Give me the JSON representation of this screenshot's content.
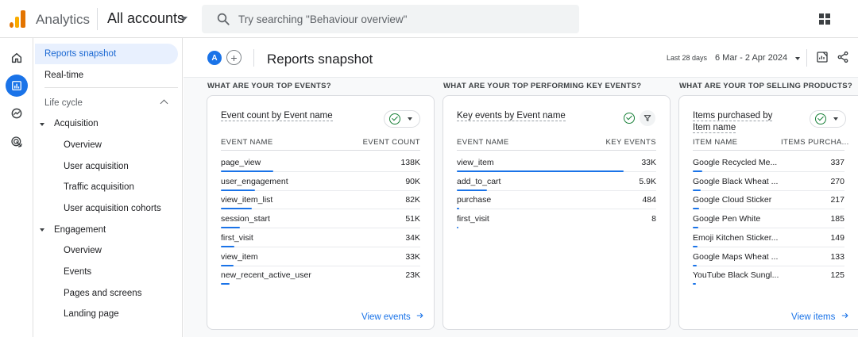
{
  "topbar": {
    "app_name": "Analytics",
    "accounts_label": "All accounts",
    "search_placeholder": "Try searching \"Behaviour overview\""
  },
  "nav": {
    "reports_snapshot": "Reports snapshot",
    "realtime": "Real-time",
    "lifecycle": "Life cycle",
    "acquisition": "Acquisition",
    "acq_items": [
      "Overview",
      "User acquisition",
      "Traffic acquisition",
      "User acquisition cohorts"
    ],
    "engagement": "Engagement",
    "eng_items": [
      "Overview",
      "Events",
      "Pages and screens",
      "Landing page"
    ]
  },
  "header": {
    "avatar_letter": "A",
    "add_symbol": "+",
    "title": "Reports snapshot",
    "date_label": "Last 28 days",
    "date_range": "6 Mar - 2 Apr 2024"
  },
  "sections": {
    "events": "WHAT ARE YOUR TOP EVENTS?",
    "key_events": "WHAT ARE YOUR TOP PERFORMING KEY EVENTS?",
    "products": "WHAT ARE YOUR TOP SELLING PRODUCTS?"
  },
  "cards": {
    "events": {
      "title": "Event count by Event name",
      "col1": "EVENT NAME",
      "col2": "EVENT COUNT",
      "rows": [
        {
          "name": "page_view",
          "value": "138K",
          "share": 1.0
        },
        {
          "name": "user_engagement",
          "value": "90K",
          "share": 0.65
        },
        {
          "name": "view_item_list",
          "value": "82K",
          "share": 0.59
        },
        {
          "name": "session_start",
          "value": "51K",
          "share": 0.37
        },
        {
          "name": "first_visit",
          "value": "34K",
          "share": 0.25
        },
        {
          "name": "view_item",
          "value": "33K",
          "share": 0.24
        },
        {
          "name": "new_recent_active_user",
          "value": "23K",
          "share": 0.17
        }
      ],
      "link": "View events"
    },
    "key_events": {
      "title": "Key events by Event name",
      "col1": "EVENT NAME",
      "col2": "KEY EVENTS",
      "rows": [
        {
          "name": "view_item",
          "value": "33K",
          "share": 1.0
        },
        {
          "name": "add_to_cart",
          "value": "5.9K",
          "share": 0.18
        },
        {
          "name": "purchase",
          "value": "484",
          "share": 0.015
        },
        {
          "name": "first_visit",
          "value": "8",
          "share": 0.003
        }
      ]
    },
    "products": {
      "title": "Items purchased by Item name",
      "col1": "ITEM NAME",
      "col2": "ITEMS PURCHA...",
      "rows": [
        {
          "name": "Google Recycled Me...",
          "value": "337",
          "share": 0.11
        },
        {
          "name": "Google Black Wheat ...",
          "value": "270",
          "share": 0.09
        },
        {
          "name": "Google Cloud Sticker",
          "value": "217",
          "share": 0.075
        },
        {
          "name": "Google Pen White",
          "value": "185",
          "share": 0.065
        },
        {
          "name": "Emoji Kitchen Sticker...",
          "value": "149",
          "share": 0.05
        },
        {
          "name": "Google Maps Wheat ...",
          "value": "133",
          "share": 0.045
        },
        {
          "name": "YouTube Black Sungl...",
          "value": "125",
          "share": 0.04
        }
      ],
      "link": "View items"
    }
  },
  "colors": {
    "accent": "#1a73e8",
    "active_nav_bg": "#e8f0fe",
    "success": "#188038",
    "logo_orange": "#e37400",
    "logo_yellow": "#f9ab00"
  }
}
